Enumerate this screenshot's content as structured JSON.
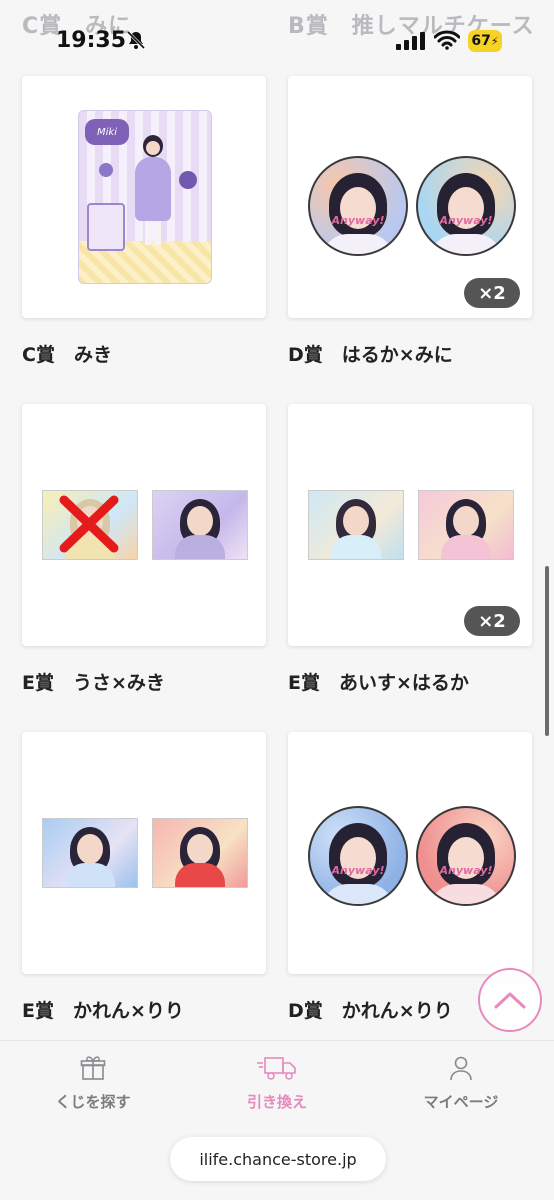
{
  "status_bar": {
    "time": "19:35",
    "battery": "67",
    "ghost_left": "C賞　みに",
    "ghost_right": "B賞　推しマルチケース"
  },
  "items": [
    {
      "label": "C賞　みき",
      "badge": null,
      "type": "acrylic-stand"
    },
    {
      "label": "D賞　はるか×みに",
      "badge": "×2",
      "type": "badges"
    },
    {
      "label": "E賞　うさ×みき",
      "badge": null,
      "type": "photos-crossed"
    },
    {
      "label": "E賞　あいす×はるか",
      "badge": "×2",
      "type": "photos"
    },
    {
      "label": "E賞　かれん×りり",
      "badge": null,
      "type": "photos"
    },
    {
      "label": "D賞　かれん×りり",
      "badge": null,
      "type": "badges"
    }
  ],
  "badge_text": "Anyway!",
  "bottom_nav": {
    "items": [
      {
        "label": "くじを探す",
        "icon": "gift-icon",
        "active": false
      },
      {
        "label": "引き換え",
        "icon": "truck-icon",
        "active": true
      },
      {
        "label": "マイページ",
        "icon": "person-icon",
        "active": false
      }
    ],
    "url": "ilife.chance-store.jp"
  },
  "colors": {
    "accent": "#e58bbd",
    "badge_bg": "#555555",
    "battery": "#f5d224"
  }
}
